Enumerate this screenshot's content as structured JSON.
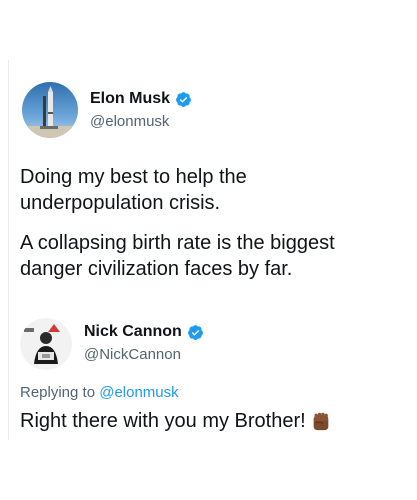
{
  "main_tweet": {
    "author_name": "Elon Musk",
    "author_handle": "@elonmusk",
    "avatar_icon": "rocket-launch-avatar",
    "verified_icon": "verified-badge-icon",
    "text_lines": [
      "Doing my best to help the",
      "underpopulation crisis.",
      "A collapsing birth rate is the biggest",
      "danger civilization faces by far."
    ]
  },
  "reply_tweet": {
    "author_name": "Nick Cannon",
    "author_handle": "@NickCannon",
    "avatar_icon": "nick-cannon-avatar",
    "verified_icon": "verified-badge-icon",
    "replying_prefix": "Replying to",
    "replying_mention": "@elonmusk",
    "text": "Right there with you my Brother!",
    "emoji_icon": "raised-fist-icon"
  },
  "colors": {
    "text_primary": "#0f1419",
    "text_secondary": "#536471",
    "link": "#1d9bf0",
    "verified": "#1d9bf0",
    "background": "#ffffff"
  }
}
